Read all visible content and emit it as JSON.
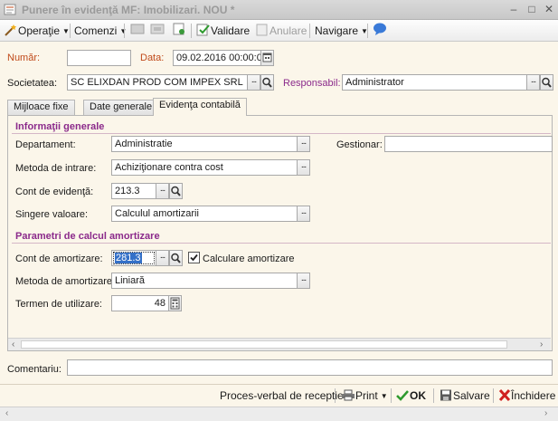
{
  "window": {
    "title": "Punere în evidenţă MF: Imobilizari. NOU *"
  },
  "toolbar": {
    "operatie": "Operaţie",
    "comenzi": "Comenzi",
    "validare": "Validare",
    "anulare": "Anulare",
    "navigare": "Navigare"
  },
  "header": {
    "numar_label": "Număr:",
    "numar_value": "",
    "data_label": "Data:",
    "data_value": "09.02.2016 00:00:0",
    "societatea_label": "Societatea:",
    "societatea_value": "SC ELIXDAN PROD COM IMPEX SRL",
    "responsabil_label": "Responsabil:",
    "responsabil_value": "Administrator"
  },
  "tabs": [
    {
      "label": "Mijloace fixe"
    },
    {
      "label": "Date generale"
    },
    {
      "label": "Evidenţa contabilă"
    }
  ],
  "info": {
    "title": "Informaţii generale",
    "departament_label": "Departament:",
    "departament_value": "Administratie",
    "gestionar_label": "Gestionar:",
    "gestionar_value": "",
    "metoda_intrare_label": "Metoda de intrare:",
    "metoda_intrare_value": "Achiziţionare contra cost",
    "cont_evidenta_label": "Cont de evidenţă:",
    "cont_evidenta_value": "213.3",
    "singere_label": "Singere valoare:",
    "singere_value": "Calculul amortizarii"
  },
  "amortizare": {
    "title": "Parametri de calcul amortizare",
    "cont_label": "Cont de amortizare:",
    "cont_value": "281.3",
    "calculare_label": "Calculare amortizare",
    "calculare_checked": true,
    "metoda_label": "Metoda de amortizare:",
    "metoda_value": "Liniară",
    "termen_label": "Termen de utilizare:",
    "termen_value": "48"
  },
  "comentariu": {
    "label": "Comentariu:",
    "value": ""
  },
  "footer": {
    "proces_verbal": "Proces-verbal de receptie",
    "print": "Print",
    "ok": "OK",
    "salvare": "Salvare",
    "inchidere": "Închidere"
  },
  "colors": {
    "label_orange": "#c04a1a",
    "label_purple": "#8b2a8b",
    "ok_green": "#2e9a2e",
    "close_red": "#d02020"
  }
}
